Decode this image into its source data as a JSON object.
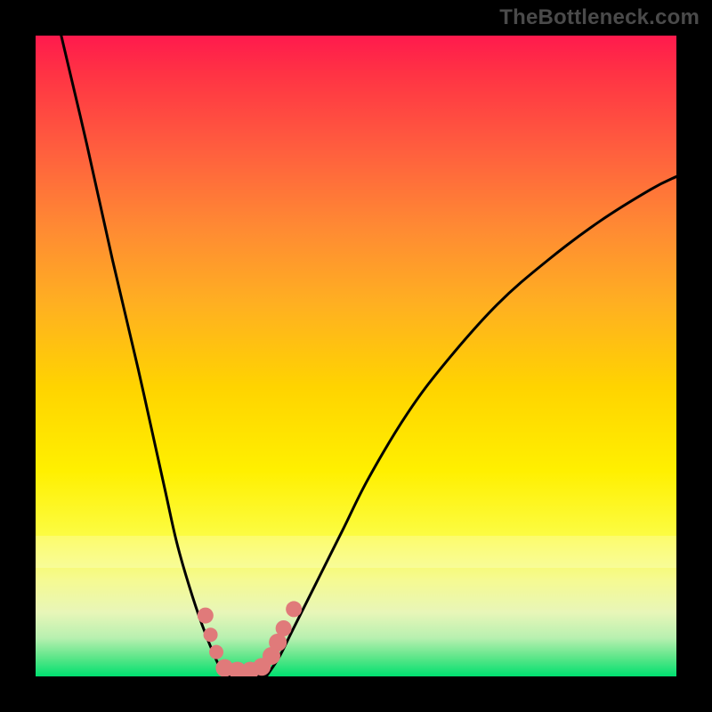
{
  "watermark": {
    "text": "TheBottleneck.com"
  },
  "chart_data": {
    "type": "line",
    "title": "",
    "xlabel": "",
    "ylabel": "",
    "xlim": [
      0,
      100
    ],
    "ylim": [
      0,
      100
    ],
    "grid": false,
    "legend": false,
    "series": [
      {
        "name": "left-branch",
        "color": "#000000",
        "x": [
          4,
          8,
          12,
          16,
          20,
          22,
          24,
          26,
          28,
          29.5
        ],
        "y": [
          100,
          83,
          65,
          48,
          30,
          21,
          14,
          8,
          3,
          0
        ]
      },
      {
        "name": "right-branch",
        "color": "#000000",
        "x": [
          36,
          38,
          40,
          44,
          48,
          52,
          58,
          64,
          72,
          80,
          88,
          96,
          100
        ],
        "y": [
          0,
          3,
          7,
          15,
          23,
          31,
          41,
          49,
          58,
          65,
          71,
          76,
          78
        ]
      },
      {
        "name": "floor",
        "color": "#000000",
        "x": [
          29.5,
          36
        ],
        "y": [
          0,
          0
        ]
      }
    ],
    "points": [
      {
        "name": "valley-marker",
        "color": "#e07a7a",
        "r": 9,
        "x": 26.5,
        "y": 9.5
      },
      {
        "name": "valley-marker",
        "color": "#e07a7a",
        "r": 8,
        "x": 27.3,
        "y": 6.5
      },
      {
        "name": "valley-marker",
        "color": "#e07a7a",
        "r": 8,
        "x": 28.2,
        "y": 3.8
      },
      {
        "name": "valley-marker",
        "color": "#e07a7a",
        "r": 10,
        "x": 29.5,
        "y": 1.3
      },
      {
        "name": "valley-marker",
        "color": "#e07a7a",
        "r": 10,
        "x": 31.5,
        "y": 0.9
      },
      {
        "name": "valley-marker",
        "color": "#e07a7a",
        "r": 10,
        "x": 33.5,
        "y": 0.9
      },
      {
        "name": "valley-marker",
        "color": "#e07a7a",
        "r": 10,
        "x": 35.3,
        "y": 1.5
      },
      {
        "name": "valley-marker",
        "color": "#e07a7a",
        "r": 10,
        "x": 36.8,
        "y": 3.2
      },
      {
        "name": "valley-marker",
        "color": "#e07a7a",
        "r": 10,
        "x": 37.8,
        "y": 5.3
      },
      {
        "name": "valley-marker",
        "color": "#e07a7a",
        "r": 9,
        "x": 38.7,
        "y": 7.5
      },
      {
        "name": "valley-marker",
        "color": "#e07a7a",
        "r": 9,
        "x": 40.3,
        "y": 10.5
      }
    ],
    "bands": [
      {
        "name": "highlight-band",
        "y_from": 17,
        "y_to": 22,
        "alpha": 0.22
      }
    ]
  }
}
